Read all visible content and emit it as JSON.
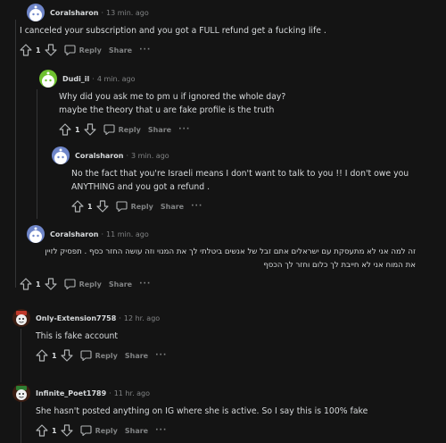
{
  "comments": [
    {
      "username": "Coralsharon",
      "time": "13 min. ago",
      "text": "I canceled your subscription and you got a FULL refund get a fucking life .",
      "votes": "1",
      "reply_label": "Reply",
      "share_label": "Share",
      "more": "···",
      "avatar": "coralsharon-avatar"
    },
    {
      "username": "Dudi_il",
      "time": "4 min. ago",
      "text": "Why did you ask me to pm u if ignored the whole day?\nmaybe the theory that u are fake profile is the truth",
      "votes": "1",
      "reply_label": "Reply",
      "share_label": "Share",
      "more": "···",
      "avatar": "dudi-avatar"
    },
    {
      "username": "Coralsharon",
      "time": "3 min. ago",
      "text": "No the fact that you're Israeli means I don't want to talk to you !! I don't owe you\nANYTHING and you got a refund .",
      "votes": "1",
      "reply_label": "Reply",
      "share_label": "Share",
      "more": "···",
      "avatar": "coralsharon-avatar"
    },
    {
      "username": "Coralsharon",
      "time": "11 min. ago",
      "text": "זה למה אני לא מתעסקת עם ישראלים אתם זבל של אנשים ביטלתי לך את המנוי וזה עושה החזר כסף . תפסיק לזיין\nאת המוח אני לא חייבת לך כלום וחזר לך הכסף",
      "votes": "1",
      "reply_label": "Reply",
      "share_label": "Share",
      "more": "···",
      "avatar": "coralsharon-avatar"
    },
    {
      "username": "Only-Extension7758",
      "time": "12 hr. ago",
      "text": "This is fake account",
      "votes": "1",
      "reply_label": "Reply",
      "share_label": "Share",
      "more": "···",
      "avatar": "snoo-avatar"
    },
    {
      "username": "Infinite_Poet1789",
      "time": "11 hr. ago",
      "text": "She hasn't posted anything on IG where she is active. So I say this is 100% fake",
      "votes": "1",
      "reply_label": "Reply",
      "share_label": "Share",
      "more": "···",
      "avatar": "snoo-avatar"
    }
  ],
  "colors": {
    "background": "#141414",
    "text": "#d7dadc",
    "meta": "#818384",
    "thread_line": "#343536"
  }
}
